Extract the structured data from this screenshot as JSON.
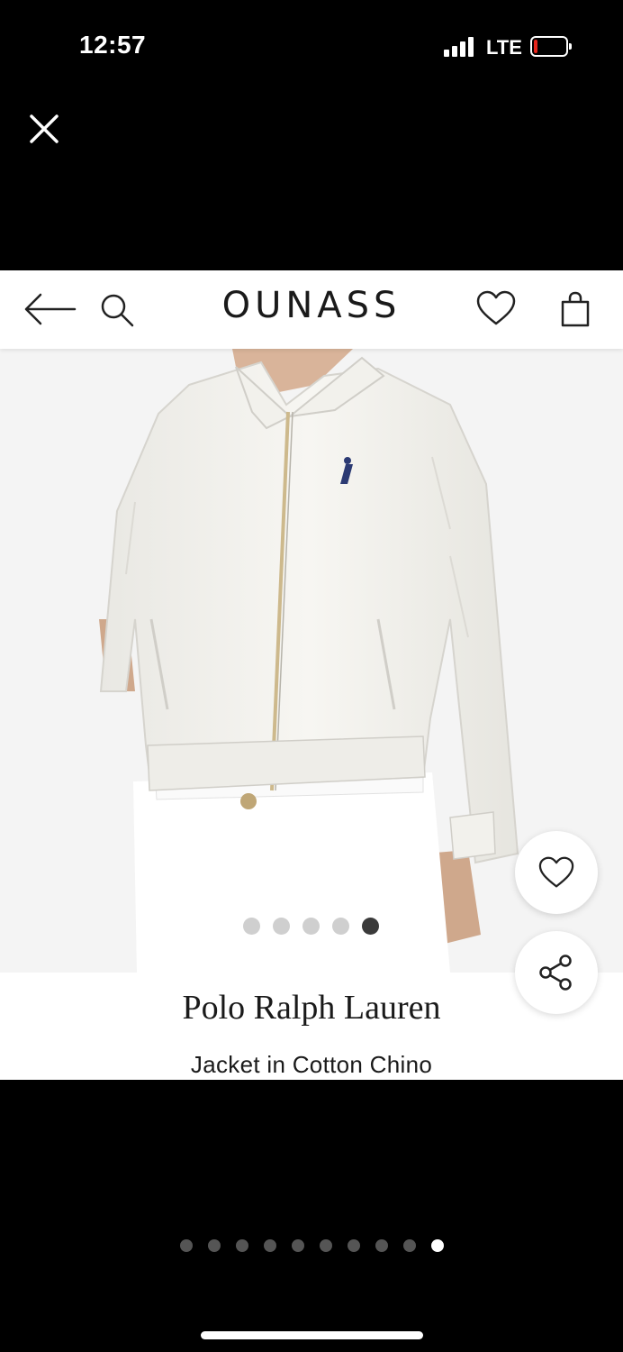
{
  "status_bar": {
    "time": "12:57",
    "carrier": "LTE",
    "battery_color": "#e5251b"
  },
  "overlay": {
    "close_icon": "close-icon"
  },
  "nav": {
    "back_icon": "arrow-left-icon",
    "search_icon": "search-icon",
    "brand": "OUNASS",
    "wishlist_icon": "heart-icon",
    "bag_icon": "shopping-bag-icon"
  },
  "product": {
    "brand": "Polo Ralph Lauren",
    "name": "Jacket in Cotton Chino",
    "image_count": 5,
    "active_image": 5
  },
  "actions": {
    "wishlist_icon": "heart-icon",
    "share_icon": "share-icon"
  },
  "story_pager": {
    "count": 10,
    "active": 10
  }
}
